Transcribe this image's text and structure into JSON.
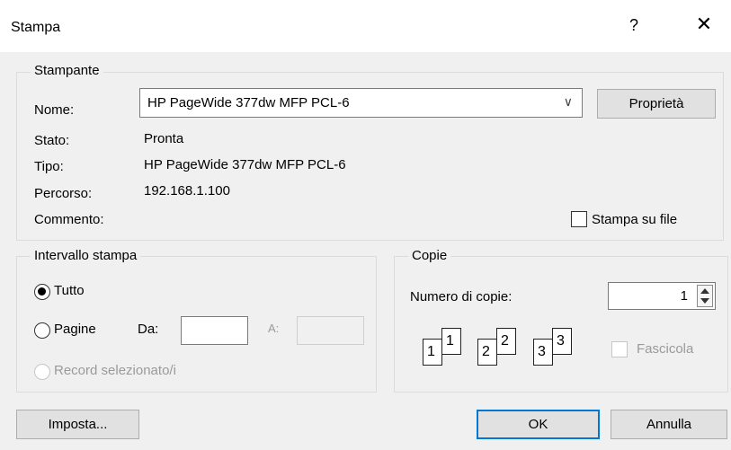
{
  "window": {
    "title": "Stampa",
    "help": "?",
    "close": "✕"
  },
  "printer": {
    "legend": "Stampante",
    "name_label": "Nome:",
    "name_value": "HP PageWide 377dw MFP PCL-6",
    "properties_button": "Proprietà",
    "status_label": "Stato:",
    "status_value": "Pronta",
    "type_label": "Tipo:",
    "type_value": "HP PageWide 377dw MFP PCL-6",
    "path_label": "Percorso:",
    "path_value": "192.168.1.100",
    "comment_label": "Commento:",
    "print_to_file_label": "Stampa su file",
    "print_to_file_checked": false
  },
  "range": {
    "legend": "Intervallo stampa",
    "all_label": "Tutto",
    "all_selected": true,
    "pages_label": "Pagine",
    "from_label": "Da:",
    "to_label": "A:",
    "from_value": "",
    "to_value": "",
    "selection_label": "Record selezionato/i"
  },
  "copies": {
    "legend": "Copie",
    "count_label": "Numero di copie:",
    "count_value": "1",
    "collate_label": "Fascicola",
    "collate_checked": false,
    "collate_icons": [
      {
        "back": "1",
        "front": "1"
      },
      {
        "back": "2",
        "front": "2"
      },
      {
        "back": "3",
        "front": "3"
      }
    ]
  },
  "buttons": {
    "setup": "Imposta...",
    "ok": "OK",
    "cancel": "Annulla"
  }
}
